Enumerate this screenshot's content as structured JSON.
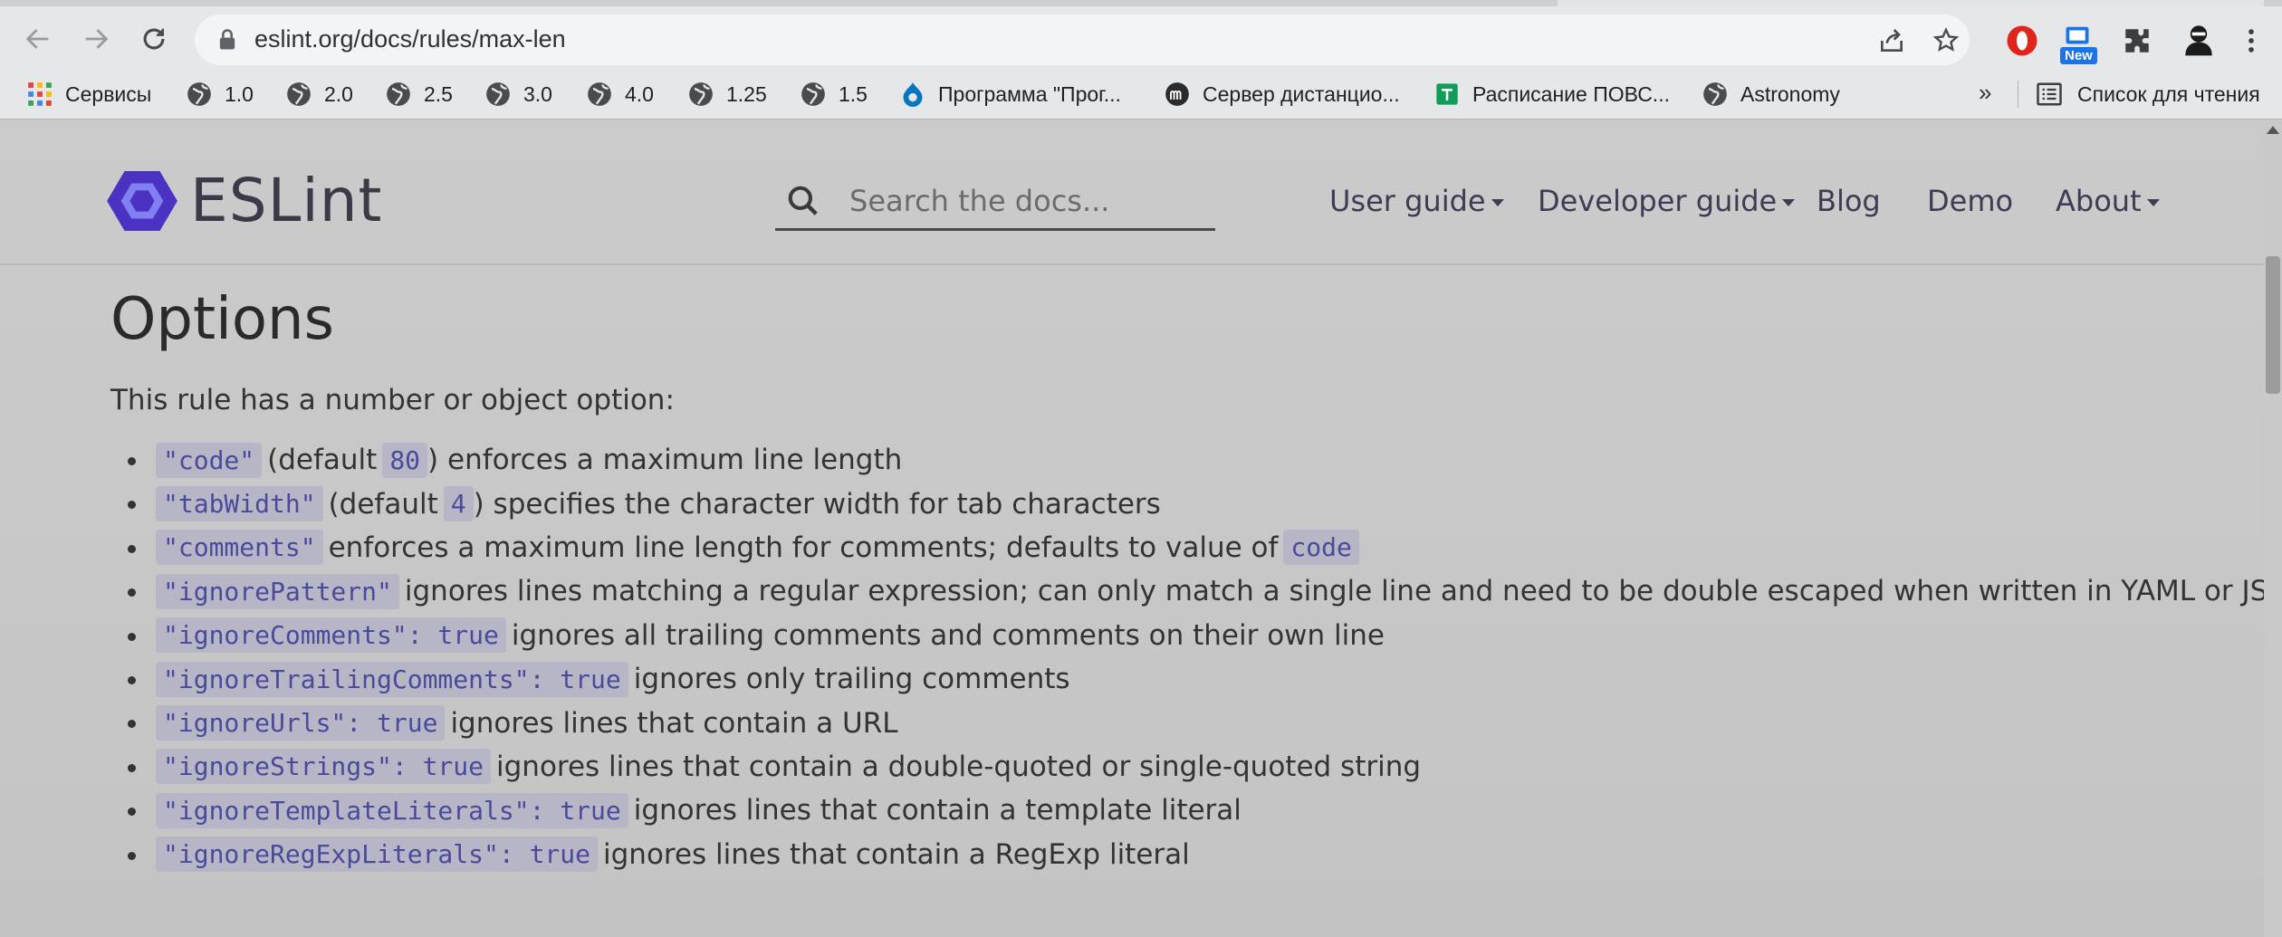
{
  "browser": {
    "url": "eslint.org/docs/rules/max-len",
    "bookmarks": [
      {
        "label": "Сервисы",
        "icon": "apps-grid-icon"
      },
      {
        "label": "1.0",
        "icon": "globe-icon"
      },
      {
        "label": "2.0",
        "icon": "globe-icon"
      },
      {
        "label": "2.5",
        "icon": "globe-icon"
      },
      {
        "label": "3.0",
        "icon": "globe-icon"
      },
      {
        "label": "4.0",
        "icon": "globe-icon"
      },
      {
        "label": "1.25",
        "icon": "globe-icon"
      },
      {
        "label": "1.5",
        "icon": "globe-icon"
      },
      {
        "label": "Программа \"Прог...",
        "icon": "drupal-icon"
      },
      {
        "label": "Сервер дистанцио...",
        "icon": "moodle-icon"
      },
      {
        "label": "Расписание ПОВС...",
        "icon": "sheets-icon"
      },
      {
        "label": "Astronomy",
        "icon": "globe-icon"
      }
    ],
    "more_label": "»",
    "reading_list_label": "Список для чтения",
    "extension_badge": "New"
  },
  "site": {
    "logo_text": "ESLint",
    "search_placeholder": "Search the docs...",
    "nav": {
      "user_guide": "User guide",
      "developer_guide": "Developer guide",
      "blog": "Blog",
      "demo": "Demo",
      "about": "About"
    }
  },
  "content": {
    "heading": "Options",
    "intro": "This rule has a number or object option:",
    "options": [
      {
        "c1": "\"code\"",
        "t1": "(default",
        "c2": "80",
        "t2": ") enforces a maximum line length"
      },
      {
        "c1": "\"tabWidth\"",
        "t1": "(default",
        "c2": "4",
        "t2": ") specifies the character width for tab characters"
      },
      {
        "c1": "\"comments\"",
        "t1": "enforces a maximum line length for comments; defaults to value of",
        "c2": "code"
      },
      {
        "c1": "\"ignorePattern\"",
        "t1": "ignores lines matching a regular expression; can only match a single line and need to be double escaped when written in YAML or JSON"
      },
      {
        "c1": "\"ignoreComments\": true",
        "t1": "ignores all trailing comments and comments on their own line"
      },
      {
        "c1": "\"ignoreTrailingComments\": true",
        "t1": "ignores only trailing comments"
      },
      {
        "c1": "\"ignoreUrls\": true",
        "t1": "ignores lines that contain a URL"
      },
      {
        "c1": "\"ignoreStrings\": true",
        "t1": "ignores lines that contain a double-quoted or single-quoted string"
      },
      {
        "c1": "\"ignoreTemplateLiterals\": true",
        "t1": "ignores lines that contain a template literal"
      },
      {
        "c1": "\"ignoreRegExpLiterals\": true",
        "t1": "ignores lines that contain a RegExp literal"
      }
    ]
  },
  "colors": {
    "eslint_brand": "#4b32c3",
    "code_bg": "#b7b6c6",
    "code_text": "#4a4a9a"
  }
}
